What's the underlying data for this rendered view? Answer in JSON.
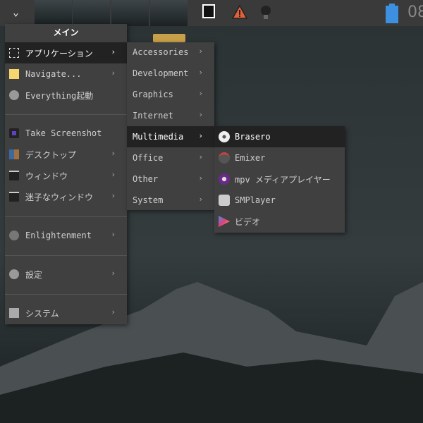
{
  "main_menu": {
    "title": "メイン",
    "items": [
      {
        "label": "アプリケーション",
        "icon": "applications-icon",
        "submenu": true
      },
      {
        "label": "Navigate...",
        "icon": "folder-icon",
        "submenu": true
      },
      {
        "label": "Everything起動",
        "icon": "gear-icon",
        "submenu": false
      },
      {
        "label": "Take Screenshot",
        "icon": "camera-icon",
        "submenu": false
      },
      {
        "label": "デスクトップ",
        "icon": "desktop-icon",
        "submenu": true
      },
      {
        "label": "ウィンドウ",
        "icon": "window-icon",
        "submenu": true
      },
      {
        "label": "迷子なウィンドウ",
        "icon": "lost-window-icon",
        "submenu": true
      },
      {
        "label": "Enlightenment",
        "icon": "enlightenment-icon",
        "submenu": true
      },
      {
        "label": "設定",
        "icon": "gear-icon",
        "submenu": true
      },
      {
        "label": "システム",
        "icon": "computer-icon",
        "submenu": true
      }
    ]
  },
  "app_menu": {
    "items": [
      "Accessories",
      "Development",
      "Graphics",
      "Internet",
      "Multimedia",
      "Office",
      "Other",
      "System"
    ],
    "selected": "Multimedia"
  },
  "multimedia_menu": {
    "items": [
      {
        "label": "Brasero",
        "icon": "disc-icon"
      },
      {
        "label": "Emixer",
        "icon": "mixer-icon"
      },
      {
        "label": "mpv メディアプレイヤー",
        "icon": "mpv-icon"
      },
      {
        "label": "SMPlayer",
        "icon": "smplayer-icon"
      },
      {
        "label": "ビデオ",
        "icon": "video-icon"
      }
    ],
    "selected": "Brasero"
  },
  "arrow": "›",
  "clock": "08",
  "colors": {
    "accent": "#3d8fe0",
    "battery": "#3d8fe0",
    "warning": "#e0603a"
  }
}
